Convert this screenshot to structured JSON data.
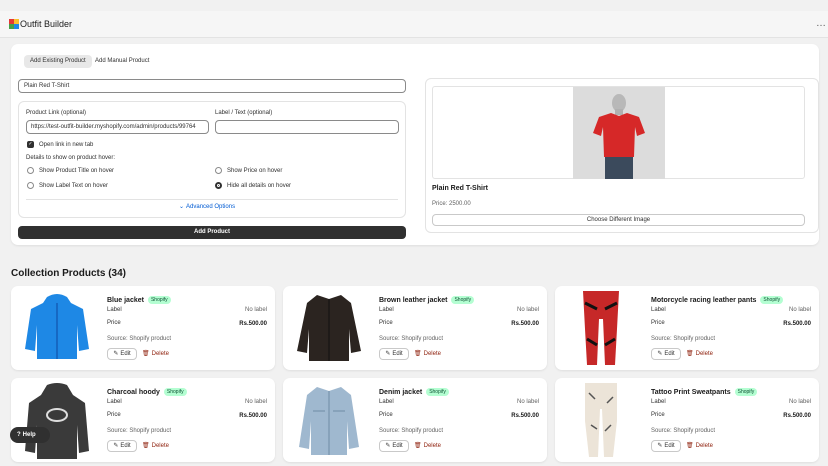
{
  "app": {
    "title": "Outfit Builder",
    "logo_icon": "outfit-logo-icon",
    "more_icon": "…"
  },
  "tabs": [
    {
      "label": "Add Existing Product",
      "active": true
    },
    {
      "label": "Add Manual Product",
      "active": false
    }
  ],
  "form": {
    "product_name": "Plain Red T-Shirt",
    "product_link_label": "Product Link (optional)",
    "product_link_value": "https://test-outfit-builder.myshopify.com/admin/products/99764",
    "label_text_label": "Label / Text (optional)",
    "label_text_value": "",
    "open_new_tab": "Open link in new tab",
    "hover_details_label": "Details to show on product hover:",
    "options": {
      "title": "Show Product Title on hover",
      "price": "Show Price on hover",
      "label": "Show Label Text on hover",
      "hide": "Hide all details on hover"
    },
    "selected_option": "hide",
    "advanced": "Advanced Options",
    "add_button": "Add Product"
  },
  "preview": {
    "name": "Plain Red T-Shirt",
    "price": "Price: 2500.00",
    "choose_button": "Choose Different Image"
  },
  "collection": {
    "title": "Collection Products (34)",
    "row_label": "Label",
    "row_price": "Price",
    "edit": "Edit",
    "delete": "Delete",
    "badge": "Shopify",
    "products": [
      {
        "name": "Blue jacket",
        "label": "No label",
        "price": "Rs.500.00",
        "source": "Source: Shopify product"
      },
      {
        "name": "Brown leather jacket",
        "label": "No label",
        "price": "Rs.500.00",
        "source": "Source: Shopify product"
      },
      {
        "name": "Motorcycle racing leather pants",
        "label": "No label",
        "price": "Rs.500.00",
        "source": "Source: Shopify product"
      },
      {
        "name": "Charcoal hoody",
        "label": "No label",
        "price": "Rs.500.00",
        "source": "Source: Shopify product"
      },
      {
        "name": "Denim jacket",
        "label": "No label",
        "price": "Rs.500.00",
        "source": "Source: Shopify product"
      },
      {
        "name": "Tattoo Print Sweatpants",
        "label": "No label",
        "price": "Rs.500.00",
        "source": "Source: Shopify product"
      }
    ]
  },
  "help": {
    "label": "Help"
  }
}
